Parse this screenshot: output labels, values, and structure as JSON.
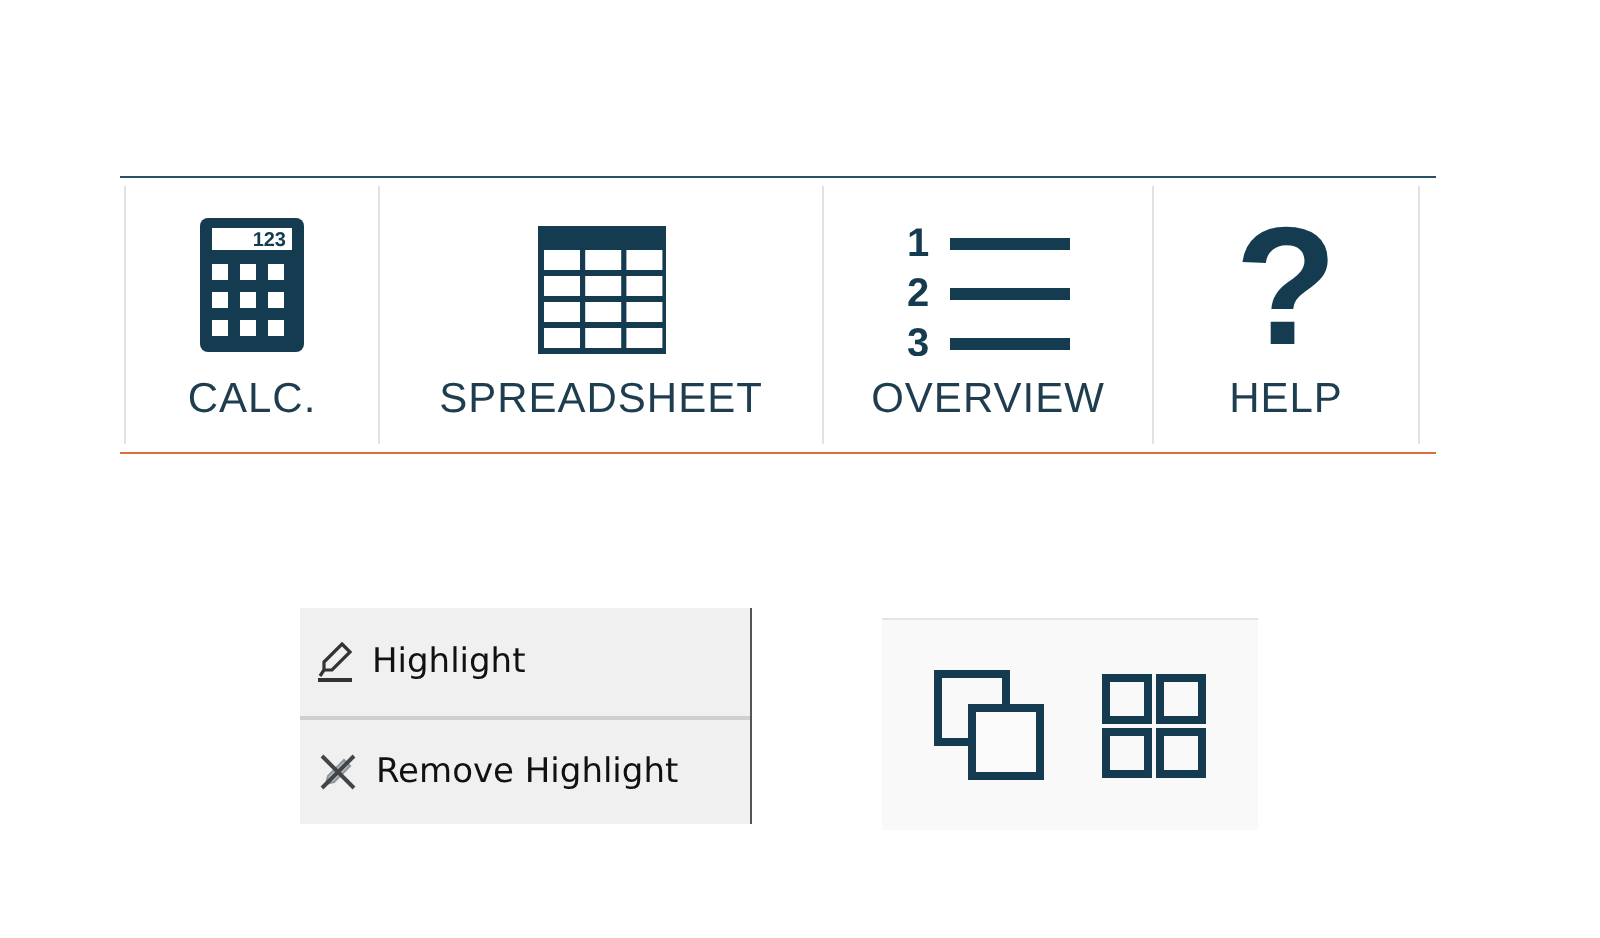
{
  "toolbar": {
    "items": [
      {
        "kind": "calculator",
        "label": "CALC.",
        "icon_text": [
          "123"
        ]
      },
      {
        "kind": "table",
        "label": "SPREADSHEET"
      },
      {
        "kind": "numbered-list",
        "label": "OVERVIEW",
        "icon_text": [
          "1",
          "2",
          "3"
        ]
      },
      {
        "kind": "glyph",
        "label": "HELP",
        "icon_text": [
          "?"
        ]
      }
    ]
  },
  "context_menu": {
    "items": [
      {
        "kind": "highlight",
        "label": "Highlight"
      },
      {
        "kind": "remove-highlight",
        "label": "Remove Highlight"
      }
    ]
  },
  "view_buttons": [
    {
      "kind": "cascade"
    },
    {
      "kind": "tile"
    }
  ]
}
